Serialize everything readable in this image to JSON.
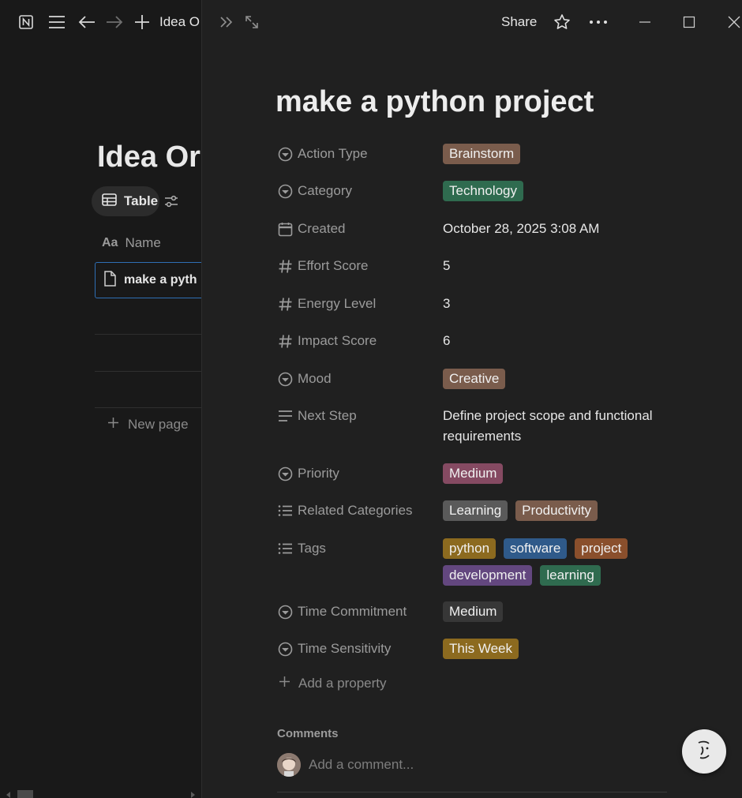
{
  "window": {
    "breadcrumb_title": "Idea Or",
    "share_label": "Share"
  },
  "background": {
    "db_title": "Idea Or",
    "view_tab_label": "Table",
    "column_header": "Name",
    "row_title": "make a pyth",
    "new_page_label": "New page"
  },
  "page": {
    "title": "make a python project",
    "properties": [
      {
        "name": "Action Type",
        "icon": "select-icon",
        "kind": "tags",
        "tags": [
          {
            "label": "Brainstorm",
            "color": "#7a5c4c"
          }
        ]
      },
      {
        "name": "Category",
        "icon": "select-icon",
        "kind": "tags",
        "tags": [
          {
            "label": "Technology",
            "color": "#2f6b4f"
          }
        ]
      },
      {
        "name": "Created",
        "icon": "calendar-icon",
        "kind": "text",
        "value": "October 28, 2025 3:08 AM"
      },
      {
        "name": "Effort Score",
        "icon": "number-icon",
        "kind": "text",
        "value": "5"
      },
      {
        "name": "Energy Level",
        "icon": "number-icon",
        "kind": "text",
        "value": "3"
      },
      {
        "name": "Impact Score",
        "icon": "number-icon",
        "kind": "text",
        "value": "6"
      },
      {
        "name": "Mood",
        "icon": "select-icon",
        "kind": "tags",
        "tags": [
          {
            "label": "Creative",
            "color": "#7a5c4c"
          }
        ]
      },
      {
        "name": "Next Step",
        "icon": "text-icon",
        "kind": "text",
        "value": "Define project scope and functional requirements"
      },
      {
        "name": "Priority",
        "icon": "select-icon",
        "kind": "tags",
        "tags": [
          {
            "label": "Medium",
            "color": "#854a62"
          }
        ]
      },
      {
        "name": "Related Categories",
        "icon": "list-icon",
        "kind": "tags",
        "tags": [
          {
            "label": "Learning",
            "color": "#5a5a5a"
          },
          {
            "label": "Productivity",
            "color": "#7a5c4c"
          }
        ]
      },
      {
        "name": "Tags",
        "icon": "list-icon",
        "kind": "tags",
        "tags": [
          {
            "label": "python",
            "color": "#8c6a1f"
          },
          {
            "label": "software",
            "color": "#2f5a8a"
          },
          {
            "label": "project",
            "color": "#8a4f2c"
          },
          {
            "label": "development",
            "color": "#63477f"
          },
          {
            "label": "learning",
            "color": "#2f6b4f"
          }
        ]
      },
      {
        "name": "Time Commitment",
        "icon": "select-icon",
        "kind": "tags",
        "tags": [
          {
            "label": "Medium",
            "color": "#373737"
          }
        ]
      },
      {
        "name": "Time Sensitivity",
        "icon": "select-icon",
        "kind": "tags",
        "tags": [
          {
            "label": "This Week",
            "color": "#8c6a1f"
          }
        ]
      }
    ],
    "add_property_label": "Add a property",
    "comments_heading": "Comments",
    "comment_placeholder": "Add a comment..."
  }
}
